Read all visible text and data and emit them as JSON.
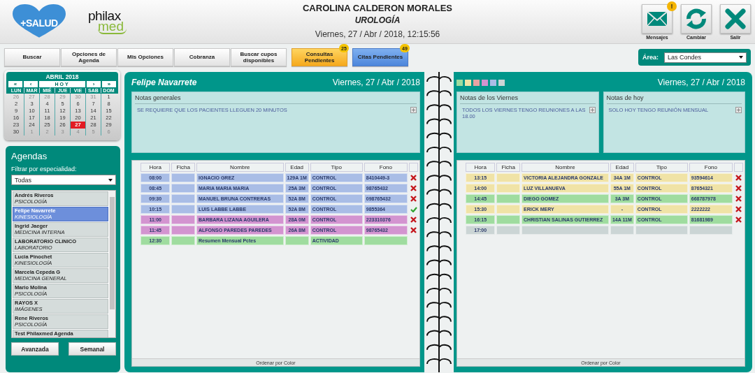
{
  "header": {
    "logo_main": "+SALUD",
    "logo_brand": "philax",
    "logo_brand_accent": "med",
    "user_name": "CAROLINA CALDERON MORALES",
    "specialty": "UROLOGÍA",
    "datetime": "Viernes, 27 / Abr / 2018, 12:15:56",
    "actions": [
      {
        "kind": "mail",
        "label": "Mensajes",
        "badge": "!"
      },
      {
        "kind": "refresh",
        "label": "Cambiar"
      },
      {
        "kind": "exit",
        "label": "Salir"
      }
    ]
  },
  "nav": {
    "buttons": [
      {
        "kind": "plain",
        "label": "Buscar"
      },
      {
        "kind": "plain",
        "label": "Opciones de Agenda"
      },
      {
        "kind": "plain",
        "label": "Mis Opciones"
      },
      {
        "kind": "plain",
        "label": "Cobranza"
      },
      {
        "kind": "plain",
        "label": "Buscar cupos disponibles"
      },
      {
        "kind": "orange",
        "label": "Consultas Pendientes",
        "badge": "25"
      },
      {
        "kind": "blue",
        "label": "Citas Pendientes",
        "badge": "49"
      }
    ],
    "area": {
      "label": "Área:",
      "value": "Las Condes"
    }
  },
  "calendar": {
    "month": "ABRIL 2018",
    "controls": [
      "«",
      "‹",
      "HOY",
      "›",
      "»"
    ],
    "weekdays": [
      "LUN",
      "MAR",
      "MIÉ",
      "JUE",
      "VIE",
      "SAB",
      "DOM"
    ],
    "weeks": [
      [
        {
          "day": "26",
          "muted": true,
          "selected": false
        },
        {
          "day": "27",
          "muted": true,
          "selected": false
        },
        {
          "day": "28",
          "muted": true,
          "selected": false
        },
        {
          "day": "29",
          "muted": true,
          "selected": false
        },
        {
          "day": "30",
          "muted": true,
          "selected": false
        },
        {
          "day": "31",
          "muted": true,
          "selected": false
        },
        {
          "day": "1",
          "muted": false,
          "selected": false
        }
      ],
      [
        {
          "day": "2",
          "muted": false,
          "selected": false
        },
        {
          "day": "3",
          "muted": false,
          "selected": false
        },
        {
          "day": "4",
          "muted": false,
          "selected": false
        },
        {
          "day": "5",
          "muted": false,
          "selected": false
        },
        {
          "day": "6",
          "muted": false,
          "selected": false
        },
        {
          "day": "7",
          "muted": false,
          "selected": false
        },
        {
          "day": "8",
          "muted": false,
          "selected": false
        }
      ],
      [
        {
          "day": "9",
          "muted": false,
          "selected": false
        },
        {
          "day": "10",
          "muted": false,
          "selected": false
        },
        {
          "day": "11",
          "muted": false,
          "selected": false
        },
        {
          "day": "12",
          "muted": false,
          "selected": false
        },
        {
          "day": "13",
          "muted": false,
          "selected": false
        },
        {
          "day": "14",
          "muted": false,
          "selected": false
        },
        {
          "day": "15",
          "muted": false,
          "selected": false
        }
      ],
      [
        {
          "day": "16",
          "muted": false,
          "selected": false
        },
        {
          "day": "17",
          "muted": false,
          "selected": false
        },
        {
          "day": "18",
          "muted": false,
          "selected": false
        },
        {
          "day": "19",
          "muted": false,
          "selected": false
        },
        {
          "day": "20",
          "muted": false,
          "selected": false
        },
        {
          "day": "21",
          "muted": false,
          "selected": false
        },
        {
          "day": "22",
          "muted": false,
          "selected": false
        }
      ],
      [
        {
          "day": "23",
          "muted": false,
          "selected": false
        },
        {
          "day": "24",
          "muted": false,
          "selected": false
        },
        {
          "day": "25",
          "muted": false,
          "selected": false
        },
        {
          "day": "26",
          "muted": false,
          "selected": false
        },
        {
          "day": "27",
          "muted": false,
          "selected": true
        },
        {
          "day": "28",
          "muted": false,
          "selected": false
        },
        {
          "day": "29",
          "muted": false,
          "selected": false
        }
      ],
      [
        {
          "day": "30",
          "muted": false,
          "selected": false
        },
        {
          "day": "1",
          "muted": true,
          "selected": false
        },
        {
          "day": "2",
          "muted": true,
          "selected": false
        },
        {
          "day": "3",
          "muted": true,
          "selected": false
        },
        {
          "day": "4",
          "muted": true,
          "selected": false
        },
        {
          "day": "5",
          "muted": true,
          "selected": false
        },
        {
          "day": "6",
          "muted": true,
          "selected": false
        }
      ]
    ]
  },
  "agendas": {
    "title": "Agendas",
    "filter_label": "Filtrar por especialidad:",
    "filter_value": "Todas",
    "items": [
      {
        "name": "Andrés Riveros",
        "specialty": "PSICOLOGÍA",
        "selected": false
      },
      {
        "name": "Felipe Navarrete",
        "specialty": "KINESIOLOGÍA",
        "selected": true
      },
      {
        "name": "Ingrid Jaeger",
        "specialty": "MEDICINA INTERNA",
        "selected": false
      },
      {
        "name": "LABORATORIO CLINICO",
        "specialty": "LABORATORIO",
        "selected": false
      },
      {
        "name": "Lucia Pinochet",
        "specialty": "KINESIOLOGÍA",
        "selected": false
      },
      {
        "name": "Marcela Cepeda G",
        "specialty": "MEDICINA GENERAL",
        "selected": false
      },
      {
        "name": "Mario Molina",
        "specialty": "PSICOLOGÍA",
        "selected": false
      },
      {
        "name": "RAYOS X",
        "specialty": "IMÁGENES",
        "selected": false
      },
      {
        "name": "Rene Riveros",
        "specialty": "PSICOLOGÍA",
        "selected": false
      },
      {
        "name": "Test Philaxmed Agenda",
        "selected": false
      }
    ],
    "buttons": [
      "Avanzada",
      "Semanal"
    ]
  },
  "pages": [
    {
      "doctor": "Felipe Navarrete",
      "date": "Viernes, 27 / Abr / 2018",
      "notes": [
        {
          "title": "Notas generales",
          "text": "SE REQUIERE QUE LOS PACIENTES LLEGUEN 20 MINUTOS"
        }
      ],
      "columns": [
        "Hora",
        "Ficha",
        "Nombre",
        "Edad",
        "Tipo",
        "Fono"
      ],
      "rows": [
        {
          "kind": "cancelled",
          "color": "#a9bde6",
          "cells": [
            "08:00",
            "",
            "IGNACIO GREZ",
            "129A 1M",
            "CONTROL",
            "8410449-3"
          ]
        },
        {
          "kind": "cancelled",
          "color": "#a9bde6",
          "cells": [
            "08:45",
            "",
            "MARIA MARIA MARIA",
            "25A 3M",
            "CONTROL",
            "98765432"
          ]
        },
        {
          "kind": "cancelled",
          "color": "#a9bde6",
          "cells": [
            "09:30",
            "",
            "MANUEL BRUNA CONTRERAS",
            "52A 8M",
            "CONTROL",
            "098765432"
          ]
        },
        {
          "kind": "confirmed",
          "color": "#a9bde6",
          "cells": [
            "10:15",
            "",
            "LUIS LABBE LABBE",
            "52A 8M",
            "CONTROL",
            "9855364"
          ]
        },
        {
          "kind": "cancelled",
          "color": "#d394d0",
          "cells": [
            "11:00",
            "",
            "BARBARA LIZANA AGUILERA",
            "28A 0M",
            "CONTROL",
            "223310376"
          ]
        },
        {
          "kind": "cancelled",
          "color": "#d394d0",
          "cells": [
            "11:45",
            "",
            "ALFONSO PAREDES PAREDES",
            "26A 8M",
            "CONTROL",
            "98765432"
          ]
        },
        {
          "kind": "activity",
          "color": "#9fdc9f",
          "cells": [
            "12:30",
            "",
            "Resumen Mensual Pctes",
            "",
            "ACTIVIDAD",
            ""
          ]
        }
      ],
      "footer": "Ordenar por Color"
    },
    {
      "legend": [
        {
          "color": "#9fdc9f"
        },
        {
          "color": "#f0e3a6"
        },
        {
          "color": "#e9a3a3"
        },
        {
          "color": "#d394d0"
        },
        {
          "color": "#a9bde6"
        },
        {
          "color": "#cbd5d5"
        }
      ],
      "date": "Viernes, 27 / Abr / 2018",
      "notes": [
        {
          "title": "Notas de los Viernes",
          "text": "TODOS LOS VIERNES TENGO REUNIONES A LAS 18.00"
        },
        {
          "title": "Notas de hoy",
          "text": "SOLO HOY TENGO REUNIÓN MENSUAL"
        }
      ],
      "columns": [
        "Hora",
        "Ficha",
        "Nombre",
        "Edad",
        "Tipo",
        "Fono"
      ],
      "rows": [
        {
          "kind": "cancelled",
          "color": "#f0e3a6",
          "cells": [
            "13:15",
            "",
            "VICTORIA ALEJANDRA GONZALE",
            "34A 1M",
            "CONTROL",
            "93594614"
          ]
        },
        {
          "kind": "cancelled",
          "color": "#f0e3a6",
          "cells": [
            "14:00",
            "",
            "LUZ VILLANUEVA",
            "55A 1M",
            "CONTROL",
            "87654321"
          ]
        },
        {
          "kind": "cancelled",
          "color": "#9fdc9f",
          "cells": [
            "14:45",
            "",
            "DIEGO GOMEZ",
            "3A 3M",
            "CONTROL",
            "668787978"
          ]
        },
        {
          "kind": "cancelled",
          "color": "#f0e3a6",
          "cells": [
            "15:30",
            "",
            "ERICK MERY",
            "-",
            "CONTROL",
            "2222222"
          ]
        },
        {
          "kind": "cancelled",
          "color": "#9fdc9f",
          "cells": [
            "16:15",
            "",
            "CHRISTIAN SALINAS GUTIERREZ",
            "14A 11M",
            "CONTROL",
            "81681989"
          ]
        },
        {
          "kind": "free",
          "color": "#cbd5d5",
          "cells": [
            "17:00",
            "",
            "",
            "",
            "",
            ""
          ]
        }
      ],
      "footer": "Ordenar por Color"
    }
  ]
}
